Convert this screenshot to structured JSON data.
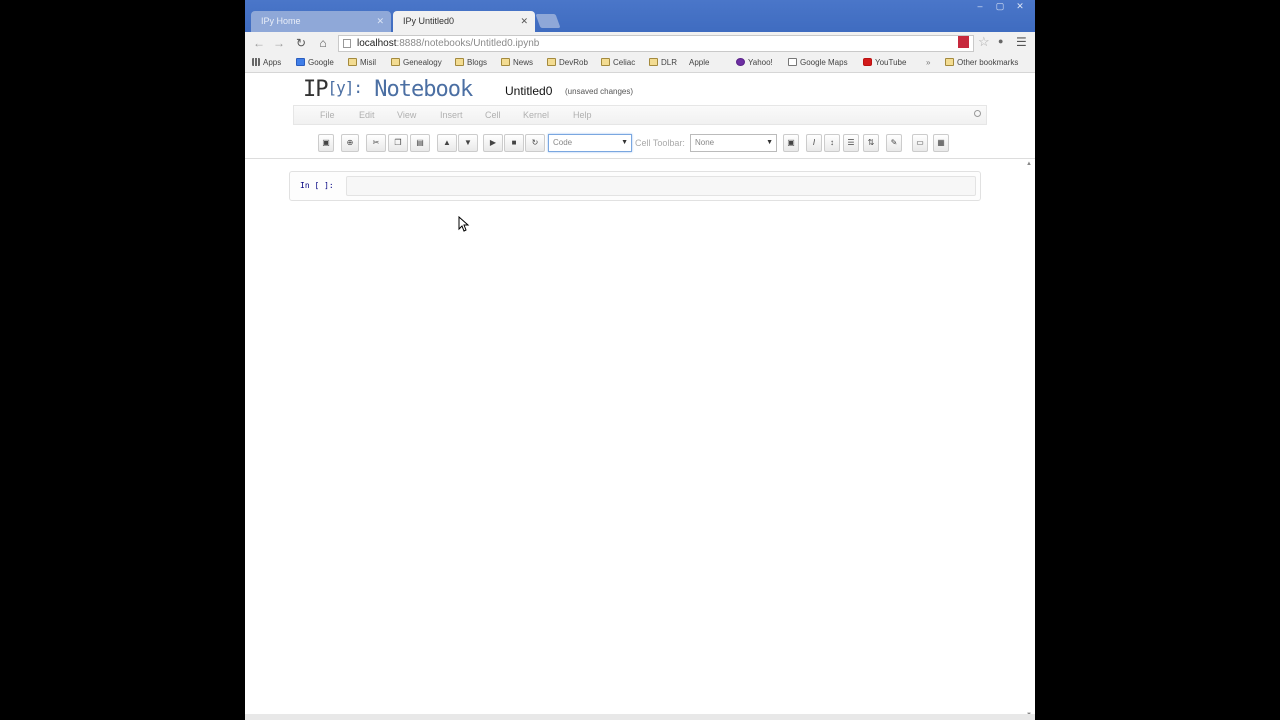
{
  "browser": {
    "tabs": [
      {
        "title": "IPy Home",
        "active": false
      },
      {
        "title": "IPy Untitled0",
        "active": true
      }
    ],
    "address": {
      "host": "localhost",
      "path": ":8888/notebooks/Untitled0.ipynb"
    },
    "window_controls": [
      "–",
      "▢",
      "✕"
    ],
    "bookmarks": [
      {
        "label": "Apps",
        "icon": "apps-icon"
      },
      {
        "label": "Google",
        "icon": "google-icon"
      },
      {
        "label": "Misil",
        "icon": "folder-icon"
      },
      {
        "label": "Genealogy",
        "icon": "folder-icon"
      },
      {
        "label": "Blogs",
        "icon": "folder-icon"
      },
      {
        "label": "News",
        "icon": "folder-icon"
      },
      {
        "label": "DevRob",
        "icon": "folder-icon"
      },
      {
        "label": "Celiac",
        "icon": "folder-icon"
      },
      {
        "label": "DLR",
        "icon": "folder-icon"
      },
      {
        "label": "Apple",
        "icon": "page-icon"
      },
      {
        "label": "Yahoo!",
        "icon": "yahoo-icon"
      },
      {
        "label": "Google Maps",
        "icon": "maps-icon"
      },
      {
        "label": "YouTube",
        "icon": "youtube-icon"
      },
      {
        "label": "Other bookmarks",
        "icon": "folder-icon"
      }
    ]
  },
  "notebook": {
    "logo": {
      "ip": "IP",
      "y": "[y]",
      "colon": ":",
      "word": " Notebook"
    },
    "name": "Untitled0",
    "status": "(unsaved changes)",
    "menu": [
      "File",
      "Edit",
      "View",
      "Insert",
      "Cell",
      "Kernel",
      "Help"
    ],
    "toolbar": {
      "cell_type": "Code",
      "cell_toolbar_label": "Cell Toolbar:",
      "cell_toolbar_value": "None"
    },
    "cell": {
      "prompt": "In [ ]:",
      "source": ""
    }
  }
}
